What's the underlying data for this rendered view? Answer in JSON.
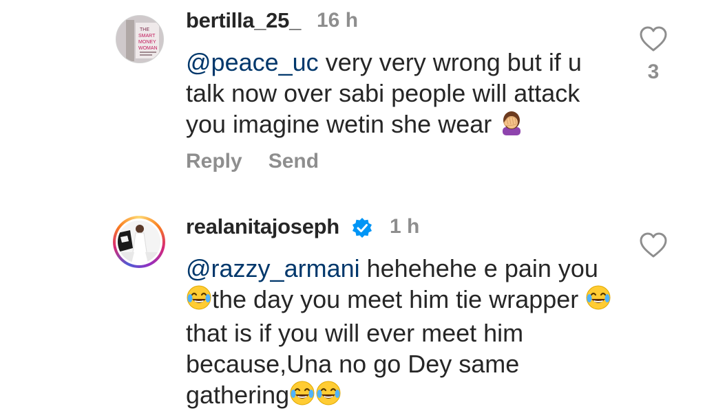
{
  "comments": [
    {
      "username": "bertilla_25_",
      "time": "16 h",
      "mention": "@peace_uc",
      "text": " very very wrong but if u talk now over sabi people will attack you imagine wetin she wear",
      "emoji_icon": "facepalm-emoji-icon",
      "actions": {
        "reply": "Reply",
        "send": "Send"
      },
      "likes": "3",
      "avatar_text": [
        "THE",
        "SMART",
        "MONEY",
        "WOMAN"
      ]
    },
    {
      "username": "realanitajoseph",
      "time": "1 h",
      "verified": true,
      "mention": "@razzy_armani",
      "text_parts": [
        " hehehehe e pain you ",
        "the day you meet him tie wrapper ",
        "that is if you will ever meet him because,Una no go Dey same gathering"
      ],
      "emoji_icon": "tears-of-joy-emoji-icon"
    }
  ],
  "colors": {
    "text": "#262626",
    "muted": "#8e8e8e",
    "mention": "#00376b",
    "verified": "#0095f6"
  }
}
